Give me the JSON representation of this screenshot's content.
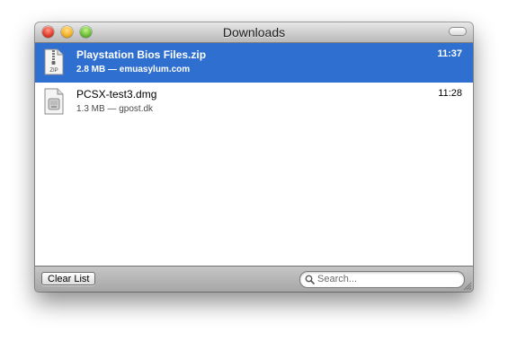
{
  "window": {
    "title": "Downloads"
  },
  "downloads": [
    {
      "name": "Playstation Bios Files.zip",
      "meta": "2.8 MB — emuasylum.com",
      "time": "11:37",
      "icon": "zip-file-icon",
      "icon_label": "ZIP",
      "selected": true
    },
    {
      "name": "PCSX-test3.dmg",
      "meta": "1.3 MB — gpost.dk",
      "time": "11:28",
      "icon": "disk-image-icon",
      "selected": false
    }
  ],
  "bottombar": {
    "clear_label": "Clear List",
    "search_placeholder": "Search..."
  },
  "colors": {
    "selection": "#2f6fd0",
    "close": "#e2412f",
    "minimize": "#f3b42a",
    "zoom": "#6ec23a"
  }
}
